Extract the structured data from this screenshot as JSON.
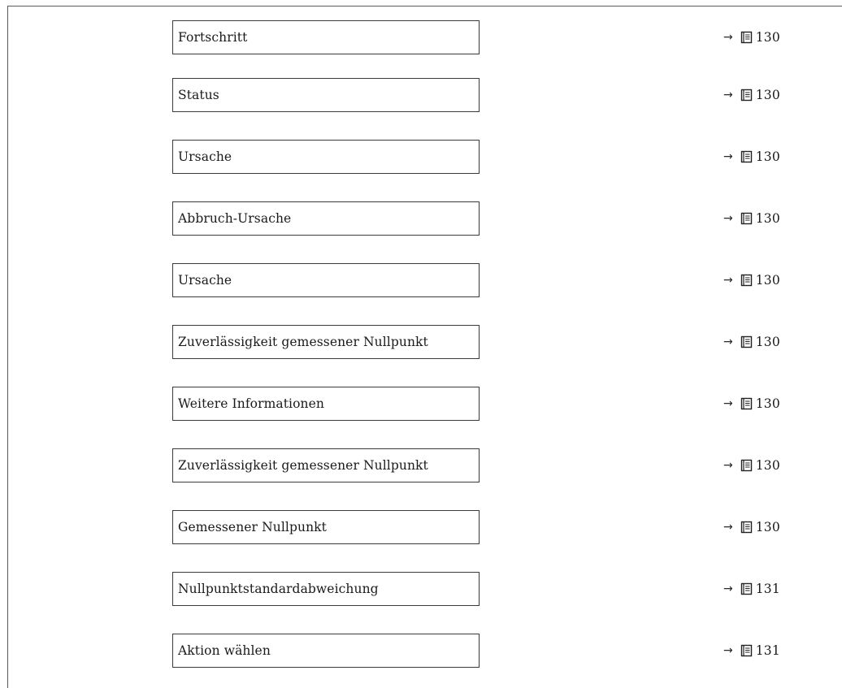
{
  "parameters": [
    {
      "label": "Fortschritt",
      "arrow": "→",
      "page": "130"
    },
    {
      "label": "Status",
      "arrow": "→",
      "page": "130"
    },
    {
      "label": "Ursache",
      "arrow": "→",
      "page": "130"
    },
    {
      "label": "Abbruch-Ursache",
      "arrow": "→",
      "page": "130"
    },
    {
      "label": "Ursache",
      "arrow": "→",
      "page": "130"
    },
    {
      "label": "Zuverlässigkeit gemessener Nullpunkt",
      "arrow": "→",
      "page": "130"
    },
    {
      "label": "Weitere Informationen",
      "arrow": "→",
      "page": "130"
    },
    {
      "label": "Zuverlässigkeit gemessener Nullpunkt",
      "arrow": "→",
      "page": "130"
    },
    {
      "label": "Gemessener Nullpunkt",
      "arrow": "→",
      "page": "130"
    },
    {
      "label": "Nullpunktstandardabweichung",
      "arrow": "→",
      "page": "131"
    },
    {
      "label": "Aktion wählen",
      "arrow": "→",
      "page": "131"
    }
  ],
  "icons": {
    "page_reference": "book-icon"
  }
}
